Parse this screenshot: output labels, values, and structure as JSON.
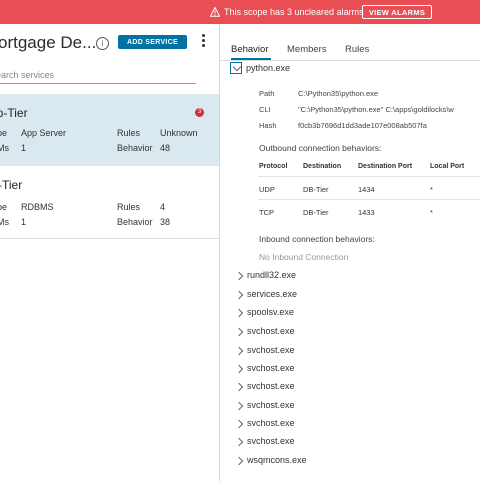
{
  "alarm": {
    "message": "This scope has 3 uncleared alarms",
    "button": "VIEW ALARMS",
    "icon": "warning-icon",
    "bg_color": "#e84e54"
  },
  "scope": {
    "title": "ortgage De...",
    "info_glyph": "i",
    "add_service": "ADD SERVICE",
    "search_placeholder": "earch services"
  },
  "services": [
    {
      "name": "pp-Tier",
      "badge": "3",
      "type_label": "pe",
      "type": "App Server",
      "count_label": "Ms",
      "count": "1",
      "rules_label": "Rules",
      "rules_value": "Unknown",
      "behavior_label": "Behavior",
      "behavior_value": "48"
    },
    {
      "name": "B-Tier",
      "type_label": "pe",
      "type": "RDBMS",
      "count_label": "Ms",
      "count": "1",
      "rules_label": "Rules",
      "rules_value": "4",
      "behavior_label": "Behavior",
      "behavior_value": "38"
    }
  ],
  "tabs": [
    "Behavior",
    "Members",
    "Rules"
  ],
  "expanded_process": {
    "name": "python.exe",
    "path_label": "Path",
    "path": "C:\\Python35\\python.exe",
    "cli_label": "CLI",
    "cli": "\"C:\\Python35\\python.exe\" C:\\apps\\goldilocks\\w",
    "hash_label": "Hash",
    "hash": "f0cb3b7696d1dd3ade107e008ab507fa",
    "outbound_title": "Outbound connection behaviors:",
    "columns": [
      "Protocol",
      "Destination",
      "Destination Port",
      "Local Port"
    ],
    "rows": [
      [
        "UDP",
        "DB-Tier",
        "1434",
        "*"
      ],
      [
        "TCP",
        "DB-Tier",
        "1433",
        "*"
      ]
    ],
    "inbound_title": "Inbound connection behaviors:",
    "inbound_empty": "No Inbound Connection"
  },
  "processes": [
    "rundll32.exe",
    "services.exe",
    "spoolsv.exe",
    "svchost.exe",
    "svchost.exe",
    "svchost.exe",
    "svchost.exe",
    "svchost.exe",
    "svchost.exe",
    "svchost.exe",
    "wsqmcons.exe"
  ]
}
